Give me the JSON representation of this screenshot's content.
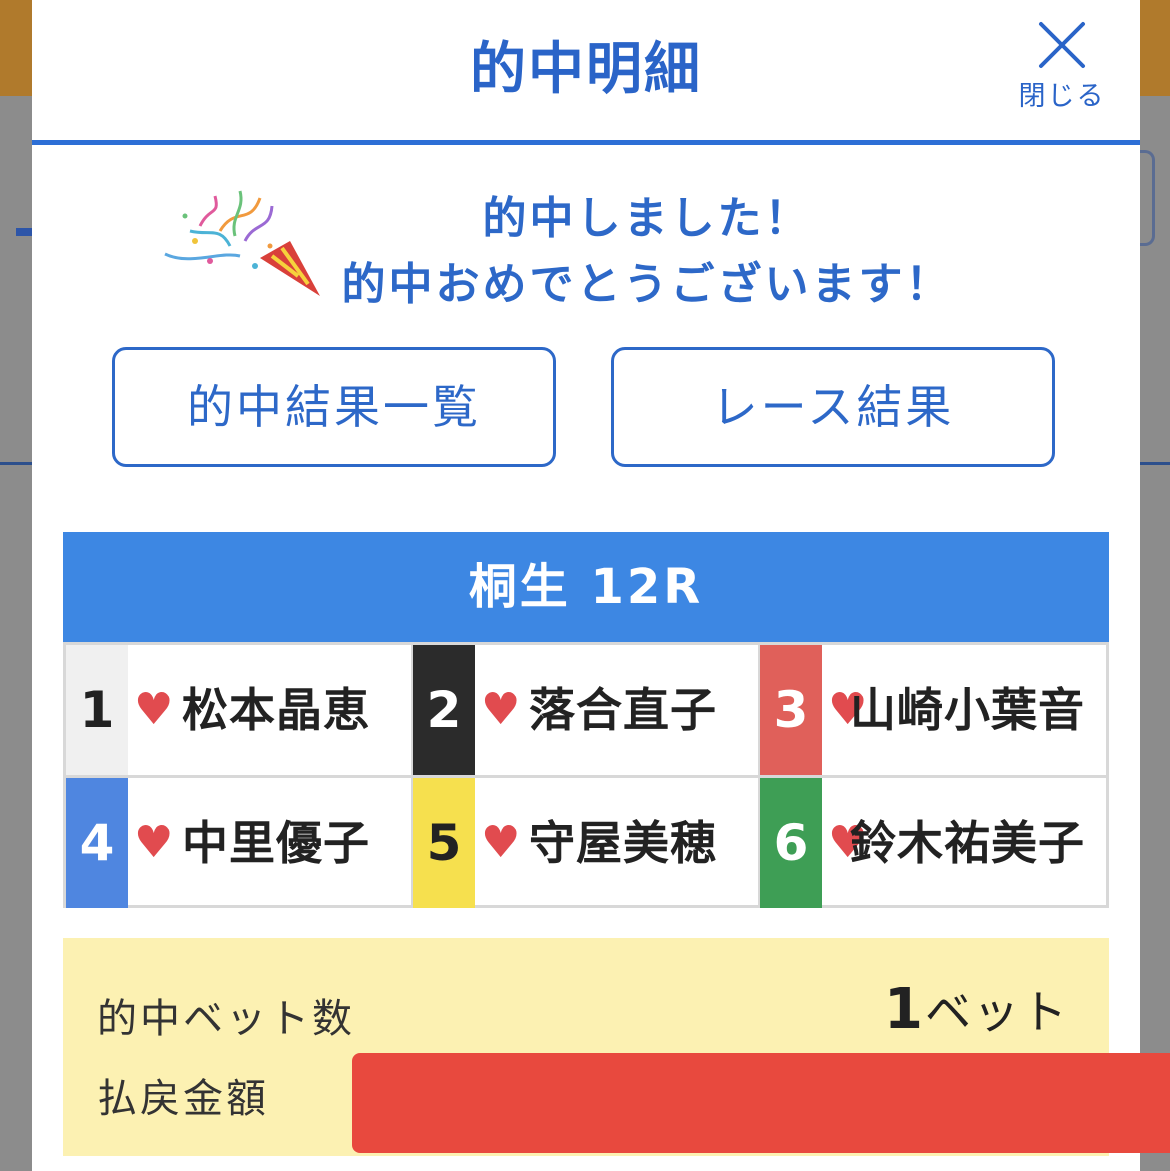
{
  "modal": {
    "title": "的中明細",
    "close_label": "閉じる"
  },
  "congrats": {
    "line1": "的中しました！",
    "line2": "的中おめでとうございます！"
  },
  "buttons": {
    "hit_results": "的中結果一覧",
    "race_results": "レース結果"
  },
  "race": {
    "title": "桐生 12R",
    "racers": [
      {
        "number": "1",
        "name": "松本晶恵",
        "color": "#f0f0f0",
        "text_color": "#222222"
      },
      {
        "number": "2",
        "name": "落合直子",
        "color": "#2b2b2b",
        "text_color": "#ffffff"
      },
      {
        "number": "3",
        "name": "山崎小葉音",
        "color": "#e0605a",
        "text_color": "#ffffff"
      },
      {
        "number": "4",
        "name": "中里優子",
        "color": "#4f86e0",
        "text_color": "#ffffff"
      },
      {
        "number": "5",
        "name": "守屋美穂",
        "color": "#f6e04e",
        "text_color": "#222222"
      },
      {
        "number": "6",
        "name": "鈴木祐美子",
        "color": "#3e9e55",
        "text_color": "#ffffff"
      }
    ]
  },
  "summary": {
    "bet_count_label": "的中ベット数",
    "bet_count_number": "1",
    "bet_count_unit": "ベット",
    "payout_label": "払戻金額"
  },
  "icons": {
    "close": "close-x-icon",
    "party": "party-popper-icon",
    "heart": "heart-icon"
  }
}
